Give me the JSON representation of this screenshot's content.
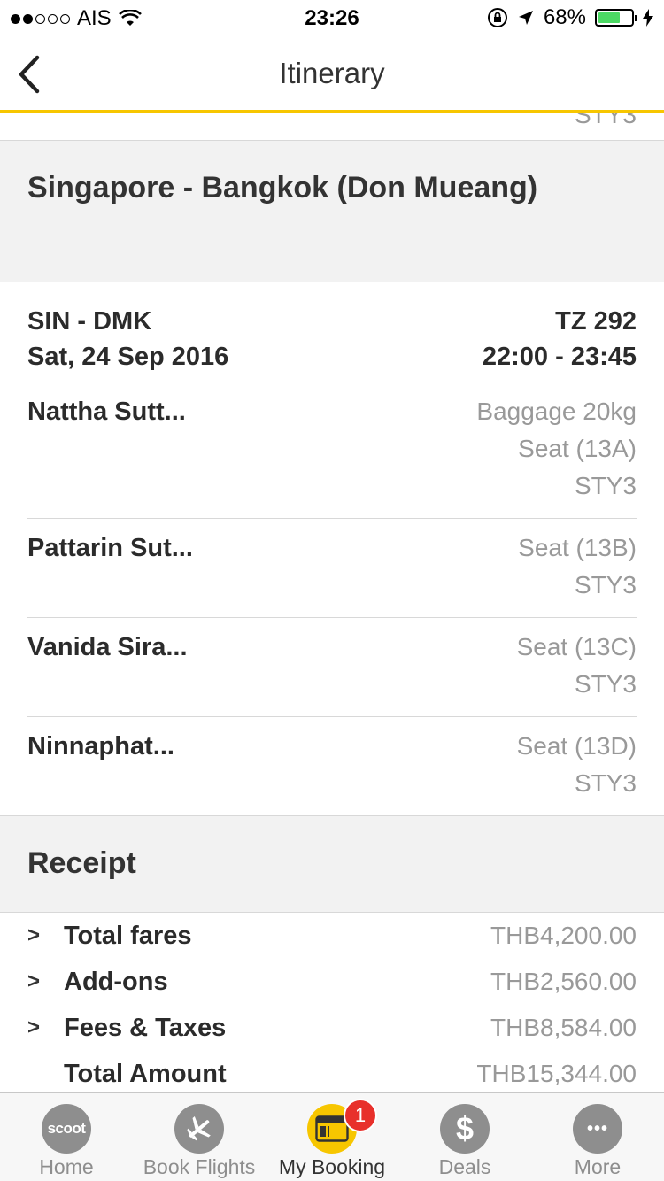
{
  "status_bar": {
    "carrier": "AIS",
    "time": "23:26",
    "battery_percent": "68%",
    "battery_level": 0.68
  },
  "nav": {
    "title": "Itinerary"
  },
  "peek_text": "STY3",
  "route": {
    "title": "Singapore - Bangkok (Don Mueang)"
  },
  "flight": {
    "route_code": "SIN - DMK",
    "date": "Sat, 24 Sep 2016",
    "flight_no": "TZ 292",
    "times": "22:00 - 23:45"
  },
  "passengers": [
    {
      "name": "Nattha Sutt...",
      "extras": [
        "Baggage 20kg",
        "Seat (13A)",
        "STY3"
      ]
    },
    {
      "name": "Pattarin Sut...",
      "extras": [
        "Seat (13B)",
        "STY3"
      ]
    },
    {
      "name": "Vanida Sira...",
      "extras": [
        "Seat (13C)",
        "STY3"
      ]
    },
    {
      "name": "Ninnaphat...",
      "extras": [
        "Seat (13D)",
        "STY3"
      ]
    }
  ],
  "receipt": {
    "title": "Receipt",
    "rows": [
      {
        "label": "Total fares",
        "amount": "THB4,200.00"
      },
      {
        "label": "Add-ons",
        "amount": "THB2,560.00"
      },
      {
        "label": "Fees & Taxes",
        "amount": "THB8,584.00"
      },
      {
        "label": "Total Amount",
        "amount": "THB15,344.00"
      }
    ]
  },
  "tabs": [
    {
      "label": "Home",
      "icon": "scoot-logo-icon",
      "icon_text": "scoot"
    },
    {
      "label": "Book Flights",
      "icon": "plane-icon"
    },
    {
      "label": "My Booking",
      "icon": "booking-ticket-icon",
      "badge": "1"
    },
    {
      "label": "Deals",
      "icon": "dollar-icon",
      "icon_text": "$"
    },
    {
      "label": "More",
      "icon": "more-dots-icon",
      "icon_text": "•••"
    }
  ],
  "colors": {
    "accent": "#f7c600",
    "badge": "#e8302b",
    "battery": "#4cd964",
    "muted": "#999999"
  }
}
